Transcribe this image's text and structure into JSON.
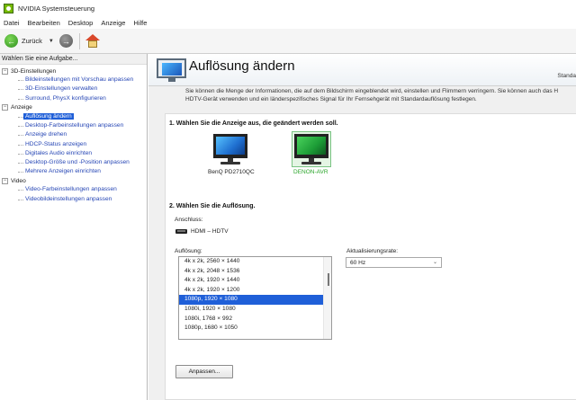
{
  "window": {
    "title": "NVIDIA Systemsteuerung"
  },
  "menu": [
    "Datei",
    "Bearbeiten",
    "Desktop",
    "Anzeige",
    "Hilfe"
  ],
  "toolbar": {
    "back_label": "Zurück"
  },
  "left": {
    "header": "Wählen Sie eine Aufgabe...",
    "categories": [
      {
        "label": "3D-Einstellungen",
        "items": [
          "Bildeinstellungen mit Vorschau anpassen",
          "3D-Einstellungen verwalten",
          "Surround, PhysX konfigurieren"
        ]
      },
      {
        "label": "Anzeige",
        "items": [
          "Auflösung ändern",
          "Desktop-Farbeinstellungen anpassen",
          "Anzeige drehen",
          "HDCP-Status anzeigen",
          "Digitales Audio einrichten",
          "Desktop-Größe und -Position anpassen",
          "Mehrere Anzeigen einrichten"
        ]
      },
      {
        "label": "Video",
        "items": [
          "Video-Farbeinstellungen anpassen",
          "Videobildeinstellungen anpassen"
        ]
      }
    ],
    "selected": "Auflösung ändern"
  },
  "main": {
    "title": "Auflösung ändern",
    "top_right": "Standa",
    "intro": "Sie können die Menge der Informationen, die auf dem Bildschirm eingeblendet wird, einstellen und Flimmern verringern. Sie können auch das H HDTV-Gerät verwenden und ein länderspezifisches Signal für Ihr Fernsehgerät mit Standardauflösung festlegen.",
    "step1": "1. Wählen Sie die Anzeige aus, die geändert werden soll.",
    "monitors": [
      {
        "label": "BenQ PD2710QC",
        "selected": false
      },
      {
        "label": "DENON-AVR",
        "selected": true
      }
    ],
    "step2": "2. Wählen Sie die Auflösung.",
    "connection_label": "Anschluss:",
    "connection_value": "HDMI – HDTV",
    "resolution_label": "Auflösung:",
    "resolutions": [
      "4k x 2k, 2560 × 1440",
      "4k x 2k, 2048 × 1536",
      "4k x 2k, 1920 × 1440",
      "4k x 2k, 1920 × 1200",
      "1080p, 1920 × 1080",
      "1080i, 1920 × 1080",
      "1080i, 1768 × 992",
      "1080p, 1680 × 1050"
    ],
    "selected_resolution": "1080p, 1920 × 1080",
    "refresh_label": "Aktualisierungsrate:",
    "refresh_value": "60 Hz",
    "customize_button": "Anpassen..."
  }
}
